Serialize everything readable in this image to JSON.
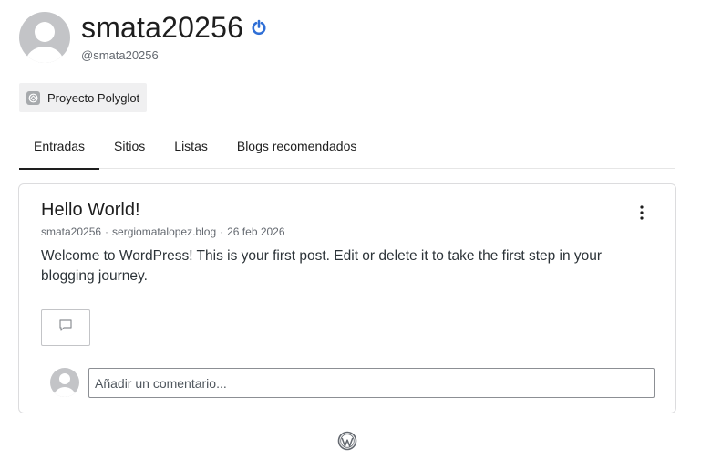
{
  "profile": {
    "display_name": "smata20256",
    "handle": "@smata20256",
    "status_icon": "power-icon"
  },
  "badge": {
    "label": "Proyecto Polyglot",
    "icon": "site-icon"
  },
  "tabs": [
    {
      "label": "Entradas",
      "active": true
    },
    {
      "label": "Sitios",
      "active": false
    },
    {
      "label": "Listas",
      "active": false
    },
    {
      "label": "Blogs recomendados",
      "active": false
    }
  ],
  "post": {
    "title": "Hello World!",
    "author": "smata20256",
    "site": "sergiomatalopez.blog",
    "date": "26 feb 2026",
    "separator": "·",
    "excerpt": "Welcome to WordPress! This is your first post. Edit or delete it to take the first step in your blogging journey.",
    "comment_placeholder": "Añadir un comentario..."
  },
  "colors": {
    "accent": "#2271b1",
    "text": "#1e1e1e",
    "muted": "#646970",
    "border": "#dcdcde"
  }
}
